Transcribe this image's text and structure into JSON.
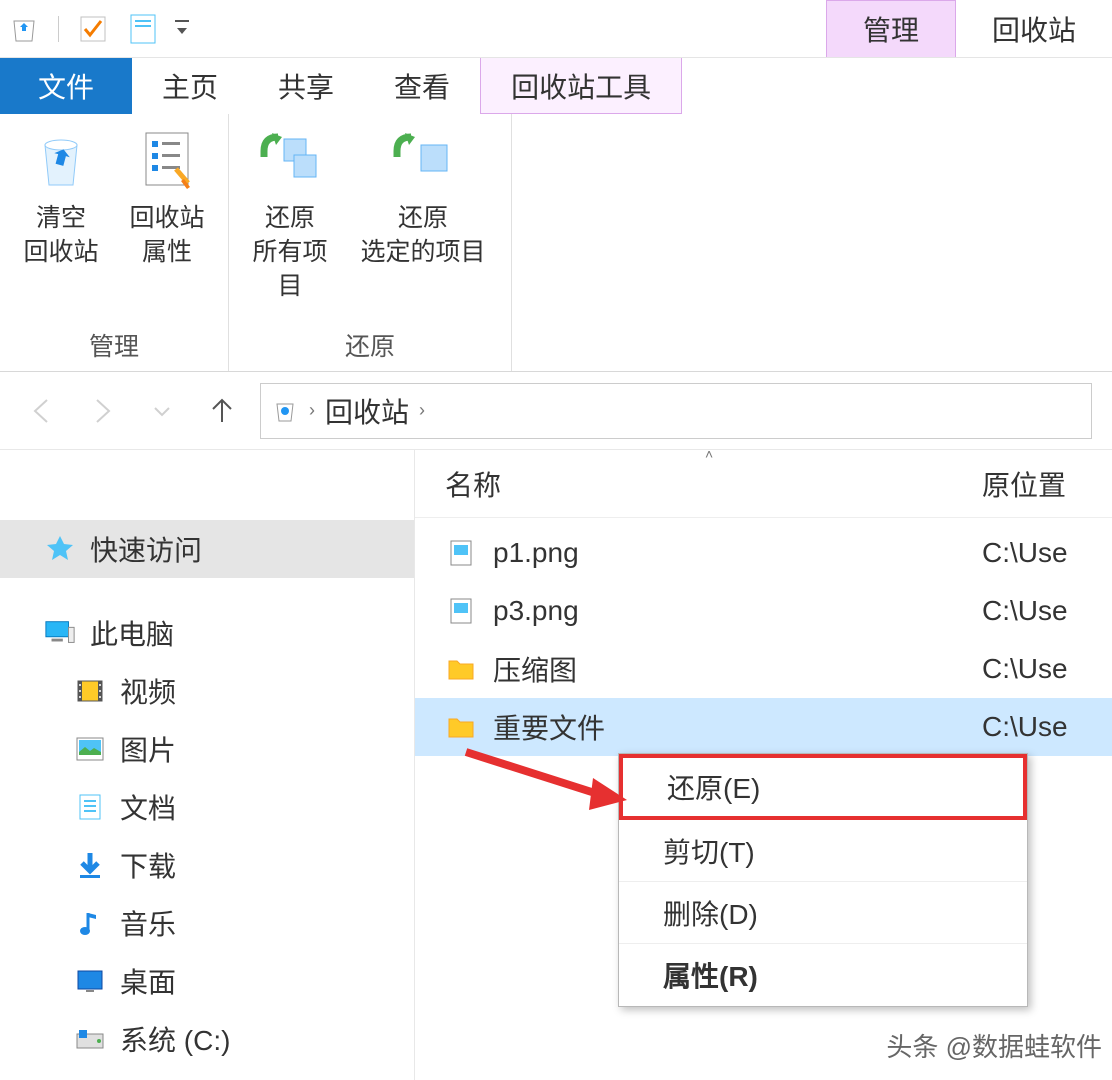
{
  "titlebar": {
    "mgmt_tab": "管理",
    "window_title": "回收站"
  },
  "ribbon_tabs": {
    "file": "文件",
    "home": "主页",
    "share": "共享",
    "view": "查看",
    "tools": "回收站工具"
  },
  "ribbon": {
    "group_manage": {
      "title": "管理",
      "empty": "清空\n回收站",
      "props": "回收站\n属性"
    },
    "group_restore": {
      "title": "还原",
      "restore_all": "还原\n所有项目",
      "restore_sel": "还原\n选定的项目"
    }
  },
  "nav": {
    "breadcrumb": "回收站"
  },
  "sidebar": {
    "items": [
      {
        "label": "快速访问"
      },
      {
        "label": "此电脑"
      },
      {
        "label": "视频"
      },
      {
        "label": "图片"
      },
      {
        "label": "文档"
      },
      {
        "label": "下载"
      },
      {
        "label": "音乐"
      },
      {
        "label": "桌面"
      },
      {
        "label": "系统 (C:)"
      }
    ]
  },
  "columns": {
    "name": "名称",
    "location": "原位置"
  },
  "files": [
    {
      "name": "p1.png",
      "type": "image",
      "location": "C:\\Use"
    },
    {
      "name": "p3.png",
      "type": "image",
      "location": "C:\\Use"
    },
    {
      "name": "压缩图",
      "type": "folder",
      "location": "C:\\Use"
    },
    {
      "name": "重要文件",
      "type": "folder",
      "location": "C:\\Use"
    }
  ],
  "context_menu": {
    "restore": "还原(E)",
    "cut": "剪切(T)",
    "delete": "删除(D)",
    "properties": "属性(R)"
  },
  "watermark": "头条 @数据蛙软件"
}
